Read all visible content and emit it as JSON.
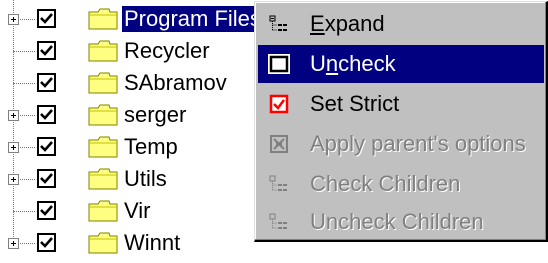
{
  "tree": {
    "items": [
      {
        "label": "Program Files",
        "expandable": true,
        "checked": true,
        "selected": true
      },
      {
        "label": "Recycler",
        "expandable": false,
        "checked": true,
        "selected": false
      },
      {
        "label": "SAbramov",
        "expandable": false,
        "checked": true,
        "selected": false
      },
      {
        "label": "serger",
        "expandable": true,
        "checked": true,
        "selected": false
      },
      {
        "label": "Temp",
        "expandable": true,
        "checked": true,
        "selected": false
      },
      {
        "label": "Utils",
        "expandable": true,
        "checked": true,
        "selected": false
      },
      {
        "label": "Vir",
        "expandable": false,
        "checked": true,
        "selected": false
      },
      {
        "label": "Winnt",
        "expandable": true,
        "checked": true,
        "selected": false
      }
    ]
  },
  "context_menu": {
    "items": [
      {
        "pre": "",
        "accel": "E",
        "post": "xpand",
        "icon": "expand-tree-icon",
        "state": "normal"
      },
      {
        "pre": "U",
        "accel": "n",
        "post": "check",
        "icon": "uncheck-box-icon",
        "state": "active"
      },
      {
        "pre": "Set Strict",
        "accel": "",
        "post": "",
        "icon": "strict-check-icon",
        "state": "normal"
      },
      {
        "pre": "Apply parent's options",
        "accel": "",
        "post": "",
        "icon": "apply-parent-icon",
        "state": "disabled"
      },
      {
        "pre": "Check Children",
        "accel": "",
        "post": "",
        "icon": "check-children-icon",
        "state": "disabled"
      },
      {
        "pre": "Uncheck Children",
        "accel": "",
        "post": "",
        "icon": "uncheck-children-icon",
        "state": "disabled"
      }
    ]
  },
  "colors": {
    "selection": "#000080",
    "menu_face": "#c0c0c0",
    "strict_red": "#ff0000",
    "folder_yellow": "#ffff80"
  }
}
